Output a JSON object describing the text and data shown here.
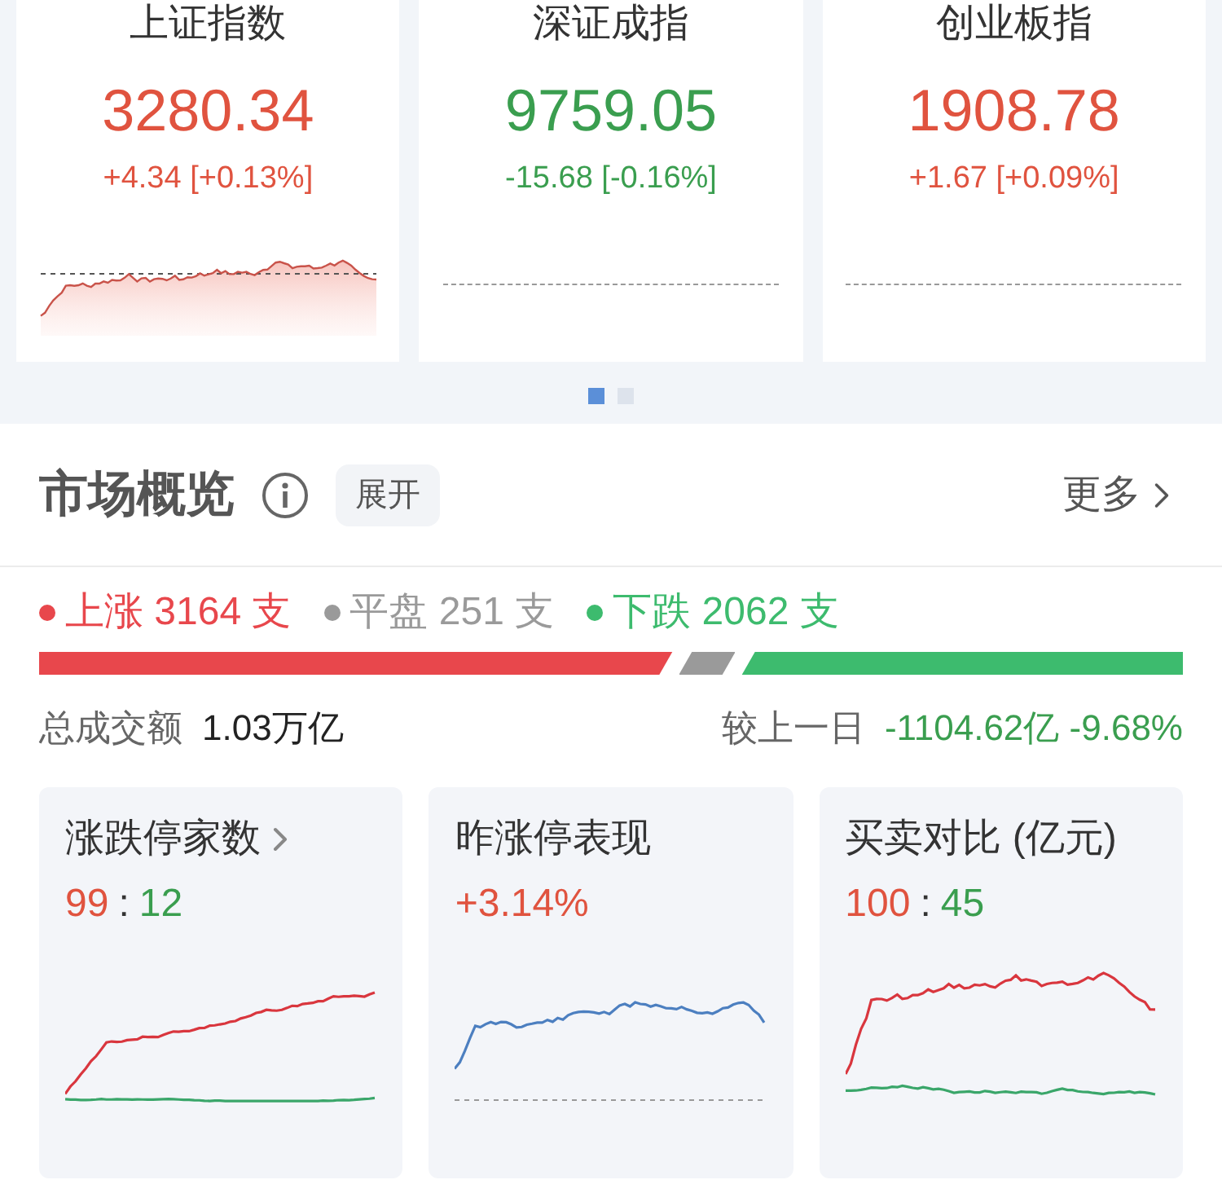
{
  "indices": [
    {
      "name": "上证指数",
      "value": "3280.34",
      "change": "+4.34 [+0.13%]",
      "kind": "up",
      "has_chart": true
    },
    {
      "name": "深证成指",
      "value": "9759.05",
      "change": "-15.68 [-0.16%]",
      "kind": "down",
      "has_chart": false
    },
    {
      "name": "创业板指",
      "value": "1908.78",
      "change": "+1.67 [+0.09%]",
      "kind": "up",
      "has_chart": false
    }
  ],
  "pager": [
    {
      "selected": true
    },
    {
      "selected": false
    }
  ],
  "overview": {
    "title": "市场概览",
    "expand": "展开",
    "more": "更多",
    "breadth": [
      {
        "label": "上涨 3164 支",
        "color": "#e8474c"
      },
      {
        "label": "平盘 251 支",
        "color": "#9a9a9a"
      },
      {
        "label": "下跌 2062 支",
        "color": "#3dbb6e"
      }
    ],
    "total_label": "总成交额",
    "total_value": "1.03万亿",
    "compare_label": "较上一日",
    "compare_value": "-1104.62亿 -9.68%"
  },
  "cards": [
    {
      "title": "涨跌停家数",
      "has_arrow": true,
      "figures": [
        {
          "text": "99",
          "kind": "up"
        },
        {
          "text": ":",
          "kind": "sep"
        },
        {
          "text": "12",
          "kind": "down"
        }
      ]
    },
    {
      "title": "昨涨停表现",
      "has_arrow": false,
      "figures": [
        {
          "text": "+3.14%",
          "kind": "up"
        }
      ]
    },
    {
      "title": "买卖对比 (亿元)",
      "has_arrow": false,
      "figures": [
        {
          "text": "100",
          "kind": "up"
        },
        {
          "text": ":",
          "kind": "sep"
        },
        {
          "text": "45",
          "kind": "down"
        }
      ]
    }
  ]
}
